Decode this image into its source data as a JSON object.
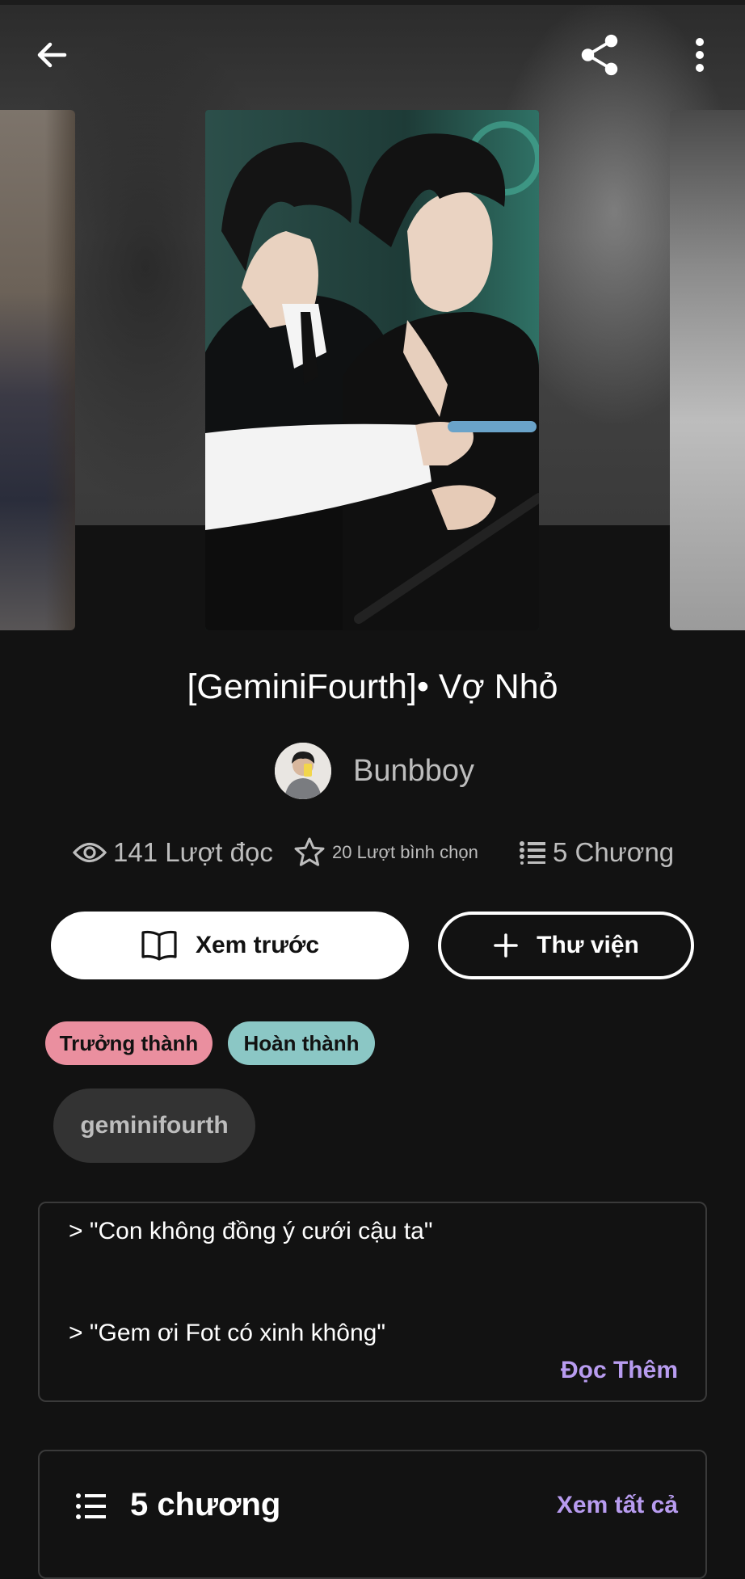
{
  "story": {
    "title": "[GeminiFourth]• Vợ Nhỏ",
    "author": "Bunbboy"
  },
  "stats": {
    "reads": "141 Lượt đọc",
    "votes": "20 Lượt bình chọn",
    "parts": "5 Chương"
  },
  "actions": {
    "preview_label": "Xem trước",
    "library_label": "Thư viện"
  },
  "tags": {
    "mature": "Trưởng thành",
    "complete": "Hoàn thành",
    "topic": "geminifourth"
  },
  "description": {
    "line1": "> \"Con không đồng ý cưới cậu ta\"",
    "line2": "> \"Gem ơi Fot có xinh không\"",
    "read_more": "Đọc Thêm"
  },
  "table_of_contents": {
    "count_label": "5 chương",
    "view_all": "Xem tất cả"
  },
  "icons": {
    "back": "arrow-left-icon",
    "share": "share-icon",
    "more": "more-vertical-icon",
    "reads": "eye-icon",
    "votes": "star-icon",
    "parts": "list-icon",
    "preview": "book-icon",
    "library": "plus-icon"
  },
  "colors": {
    "background": "#121212",
    "accent": "#b89cf0",
    "mature_tag": "#ea8f9f",
    "complete_tag": "#8bc7c5"
  }
}
